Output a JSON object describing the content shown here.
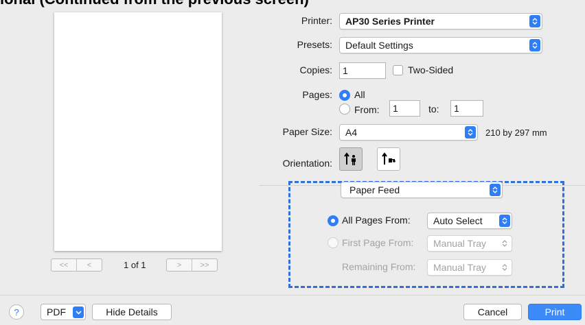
{
  "cut_header": "ional (Continued from the previous screen)",
  "pager": {
    "first_label": "<<",
    "prev_label": "<",
    "next_label": ">",
    "last_label": ">>",
    "page_indicator": "1 of 1"
  },
  "printer": {
    "label": "Printer:",
    "value": "AP30 Series Printer"
  },
  "presets": {
    "label": "Presets:",
    "value": "Default Settings"
  },
  "copies": {
    "label": "Copies:",
    "value": "1",
    "two_sided_label": "Two-Sided",
    "two_sided_checked": false
  },
  "pages": {
    "label": "Pages:",
    "all_label": "All",
    "from_label": "From:",
    "from_value": "1",
    "to_label": "to:",
    "to_value": "1",
    "selected": "All"
  },
  "paper_size": {
    "label": "Paper Size:",
    "value": "A4",
    "dimensions": "210 by 297 mm"
  },
  "orientation": {
    "label": "Orientation:",
    "selected": "portrait",
    "options": [
      "portrait",
      "landscape"
    ]
  },
  "section_popup": {
    "value": "Paper Feed"
  },
  "paper_feed": {
    "all_pages_from_label": "All Pages From:",
    "all_pages_from_value": "Auto Select",
    "first_page_from_label": "First Page From:",
    "first_page_from_value": "Manual Tray",
    "remaining_from_label": "Remaining From:",
    "remaining_from_value": "Manual Tray",
    "selected": "All Pages From"
  },
  "footer": {
    "help_label": "?",
    "pdf_label": "PDF",
    "hide_details_label": "Hide Details",
    "cancel_label": "Cancel",
    "print_label": "Print"
  },
  "colors": {
    "accent": "#2f7ef6",
    "highlight_border": "#2f6fe0"
  },
  "icons": [
    "chevron-updown-icon",
    "chevron-down-icon",
    "portrait-icon",
    "landscape-icon"
  ]
}
